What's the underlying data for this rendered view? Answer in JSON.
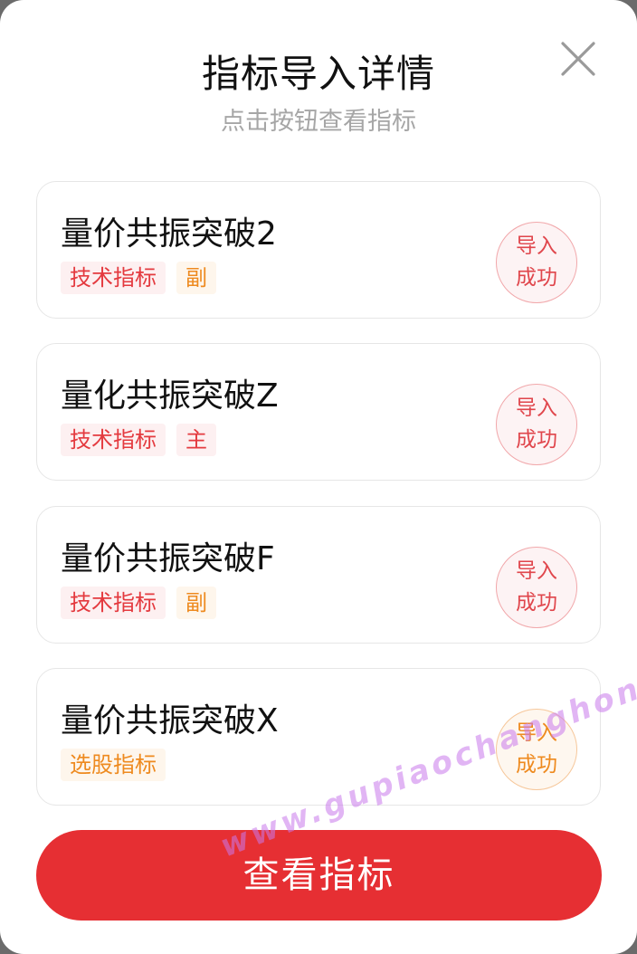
{
  "dialog": {
    "title": "指标导入详情",
    "subtitle": "点击按钮查看指标",
    "close_icon": "close-icon"
  },
  "indicators": [
    {
      "name": "量价共振突破2",
      "tags": [
        {
          "label": "技术指标",
          "color": "#e43a3f"
        },
        {
          "label": "副",
          "color": "#ee8a1f"
        }
      ],
      "status_line1": "导入",
      "status_line2": "成功",
      "status_color": "#e0464c"
    },
    {
      "name": "量化共振突破Z",
      "tags": [
        {
          "label": "技术指标",
          "color": "#e43a3f"
        },
        {
          "label": "主",
          "color": "#e43a3f"
        }
      ],
      "status_line1": "导入",
      "status_line2": "成功",
      "status_color": "#e0464c"
    },
    {
      "name": "量价共振突破F",
      "tags": [
        {
          "label": "技术指标",
          "color": "#e43a3f"
        },
        {
          "label": "副",
          "color": "#ee8a1f"
        }
      ],
      "status_line1": "导入",
      "status_line2": "成功",
      "status_color": "#e0464c"
    },
    {
      "name": "量价共振突破X",
      "tags": [
        {
          "label": "选股指标",
          "color": "#ee8a1f"
        }
      ],
      "status_line1": "导入",
      "status_line2": "成功",
      "status_color": "#ee8a1f"
    }
  ],
  "actions": {
    "view_label": "查看指标",
    "button_color": "#e62f33"
  },
  "watermark": "www.gupiaochanghong.com"
}
